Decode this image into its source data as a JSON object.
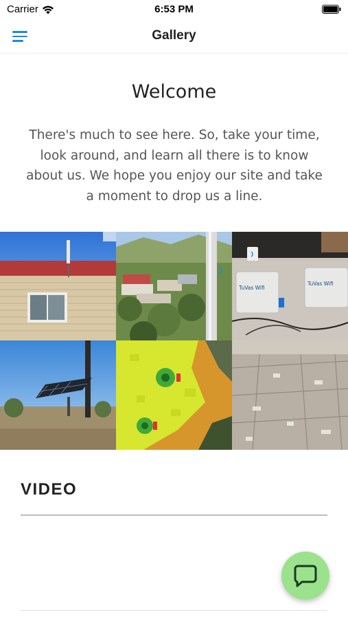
{
  "status_bar": {
    "carrier": "Carrier",
    "time": "6:53 PM"
  },
  "nav": {
    "title": "Gallery",
    "menu_icon": "hamburger-menu-icon"
  },
  "welcome": {
    "title": "Welcome",
    "body": "There's much to see here. So, take your time, look around, and learn all there is to know about us. We hope you enjoy our site and take a moment to drop us a line."
  },
  "gallery": {
    "tiles": [
      {
        "name": "building-antenna-photo"
      },
      {
        "name": "neighborhood-antenna-photo"
      },
      {
        "name": "equipment-boxes-photo",
        "label_left": "TuVas Wifi",
        "label_right": "TuVas Wifi"
      },
      {
        "name": "solar-panel-photo"
      },
      {
        "name": "coverage-map-photo"
      },
      {
        "name": "aerial-desert-photo"
      }
    ]
  },
  "video": {
    "heading": "VIDEO"
  },
  "chat": {
    "icon": "chat-bubble-icon"
  },
  "colors": {
    "accent": "#1e88e5",
    "chat_fab": "#9be28c"
  }
}
